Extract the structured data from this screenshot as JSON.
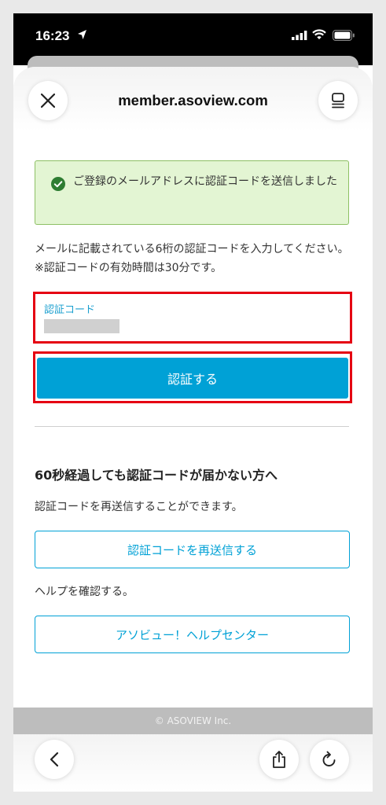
{
  "status_bar": {
    "time": "16:23"
  },
  "browser": {
    "url": "member.asoview.com"
  },
  "alert": {
    "message": "ご登録のメールアドレスに認証コードを送信しました"
  },
  "instruction": "メールに記載されている6桁の認証コードを入力してください。※認証コードの有効時間は30分です。",
  "code_field": {
    "label": "認証コード"
  },
  "verify_button": "認証する",
  "resend": {
    "heading": "60秒経過しても認証コードが届かない方へ",
    "description": "認証コードを再送信することができます。",
    "button": "認証コードを再送信する"
  },
  "help": {
    "text": "ヘルプを確認する。",
    "button": "アソビュー！ヘルプセンター"
  },
  "footer": "© ASOVIEW Inc.",
  "colors": {
    "accent": "#00a1d6",
    "highlight": "#e50012",
    "success_bg": "#e3f5d3",
    "success_icon": "#2e7d32"
  }
}
